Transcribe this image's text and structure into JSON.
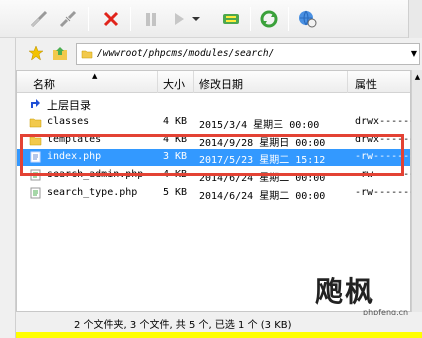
{
  "toolbar": {
    "icons": [
      "connect-icon",
      "disconnect-icon",
      "delete-icon",
      "pause-icon",
      "play-icon",
      "dropdown-icon",
      "sync-icon",
      "refresh-icon",
      "globe-icon"
    ]
  },
  "path": {
    "value": "/wwwroot/phpcms/modules/search/"
  },
  "list": {
    "columns": [
      "名称",
      "大小",
      "修改日期",
      "属性"
    ],
    "parent": "上层目录",
    "rows": [
      {
        "name": "classes",
        "size": "4 KB",
        "date": "2015/3/4 星期三 00:00",
        "attr": "drwx------"
      },
      {
        "name": "templates",
        "size": "4 KB",
        "date": "2014/9/28 星期日 00:00",
        "attr": "drwx------"
      },
      {
        "name": "index.php",
        "size": "3 KB",
        "date": "2017/5/23 星期二 15:12",
        "attr": "-rw-------"
      },
      {
        "name": "search_admin.php",
        "size": "4 KB",
        "date": "2014/6/24 星期二 00:00",
        "attr": "-rw-------"
      },
      {
        "name": "search_type.php",
        "size": "5 KB",
        "date": "2014/6/24 星期二 00:00",
        "attr": "-rw-------"
      }
    ]
  },
  "status": {
    "text": "2 个文件夹, 3 个文件, 共 5 个, 已选 1 个 (3 KB)"
  },
  "watermark": {
    "main": "飑枫",
    "sub": "phpfeng.cn"
  },
  "colors": {
    "selection": "#3399ff",
    "highlight": "#e34234"
  }
}
